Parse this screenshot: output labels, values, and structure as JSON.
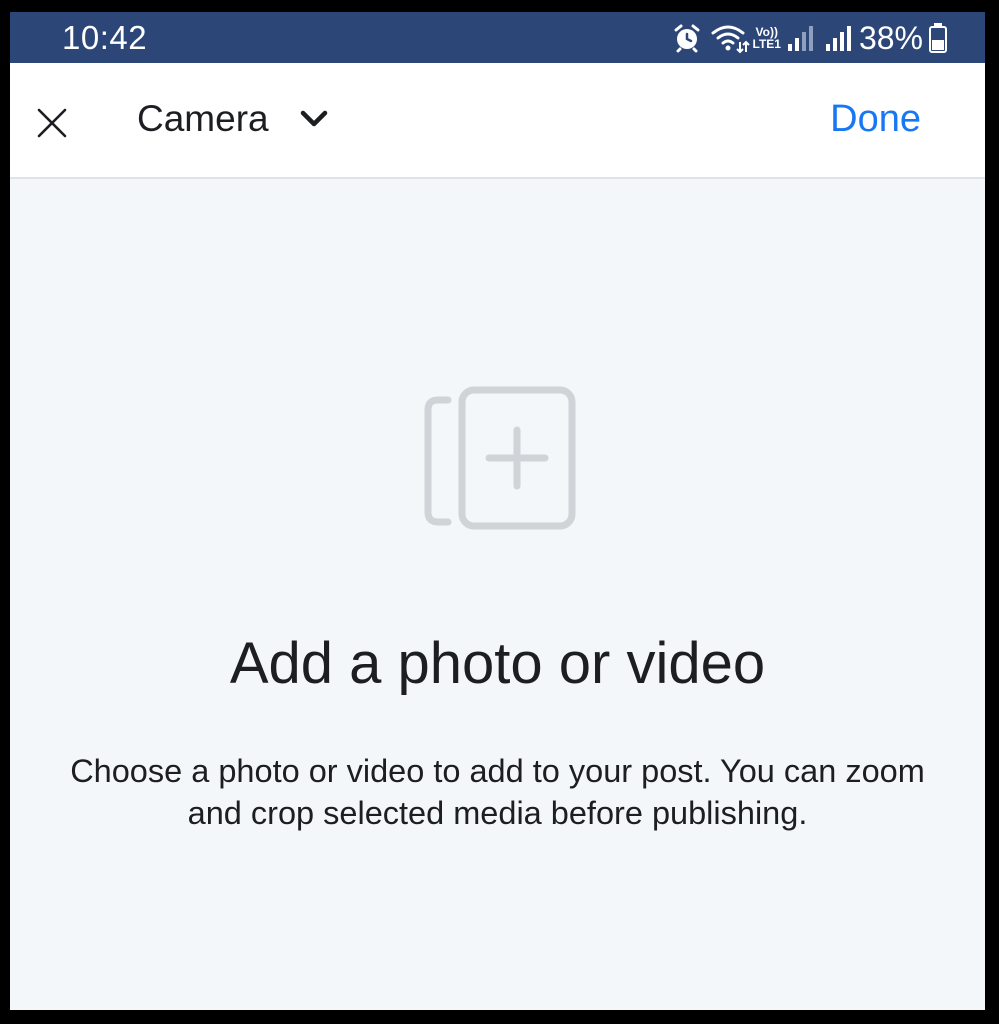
{
  "status_bar": {
    "time": "10:42",
    "volte_top": "Vo))",
    "volte_bottom": "LTE1",
    "battery_percent": "38%",
    "icons": [
      "alarm-icon",
      "wifi-icon",
      "volte-icon",
      "signal-sim1-icon",
      "signal-sim2-icon",
      "battery-icon"
    ]
  },
  "app_bar": {
    "close_icon": "close-icon",
    "source_label": "Camera",
    "source_chevron_icon": "chevron-down-icon",
    "done_label": "Done"
  },
  "empty_state": {
    "icon": "add-media-icon",
    "title": "Add a photo or video",
    "description": "Choose a photo or video to add to your post. You can zoom and crop selected media before publishing."
  },
  "colors": {
    "status_bar_bg": "#2c4677",
    "accent": "#1877f2",
    "background": "#f4f7fa",
    "text": "#1c1e21",
    "icon_gray": "#d0d3d7"
  }
}
